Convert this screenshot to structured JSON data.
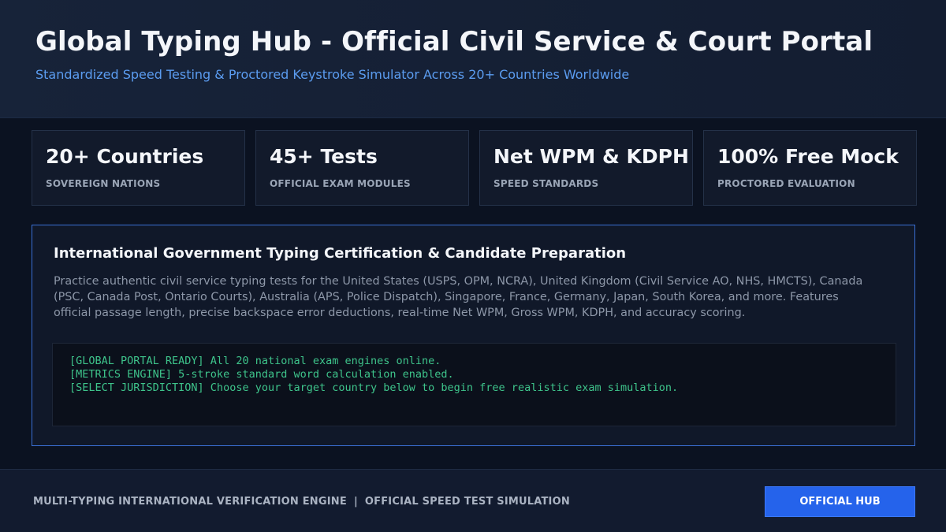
{
  "header": {
    "title": "Global Typing Hub - Official Civil Service & Court Portal",
    "subtitle": "Standardized Speed Testing & Proctored Keystroke Simulator Across 20+ Countries Worldwide"
  },
  "stats": [
    {
      "value": "20+ Countries",
      "label": "SOVEREIGN NATIONS"
    },
    {
      "value": "45+ Tests",
      "label": "OFFICIAL EXAM MODULES"
    },
    {
      "value": "Net WPM & KDPH",
      "label": "SPEED STANDARDS"
    },
    {
      "value": "100% Free Mock",
      "label": "PROCTORED EVALUATION"
    }
  ],
  "panel": {
    "title": "International Government Typing Certification & Candidate Preparation",
    "description": "Practice authentic civil service typing tests for the United States (USPS, OPM, NCRA), United Kingdom (Civil Service AO, NHS, HMCTS), Canada (PSC, Canada Post, Ontario Courts), Australia (APS, Police Dispatch), Singapore, France, Germany, Japan, South Korea, and more. Features official passage length, precise backspace error deductions, real-time Net WPM, Gross WPM, KDPH, and accuracy scoring.",
    "console_lines": [
      "[GLOBAL PORTAL READY] All 20 national exam engines online.",
      "[METRICS ENGINE] 5-stroke standard word calculation enabled.",
      "[SELECT JURISDICTION] Choose your target country below to begin free realistic exam simulation."
    ]
  },
  "footer": {
    "left_text": "MULTI-TYPING INTERNATIONAL VERIFICATION ENGINE",
    "separator": "|",
    "right_text": "OFFICIAL SPEED TEST SIMULATION",
    "button_label": "OFFICIAL HUB"
  },
  "colors": {
    "background": "#0b1221",
    "accent": "#2563eb",
    "subtitle": "#5b9cf0",
    "console_text": "#3ec48b",
    "panel_border": "#3a6fd4"
  }
}
